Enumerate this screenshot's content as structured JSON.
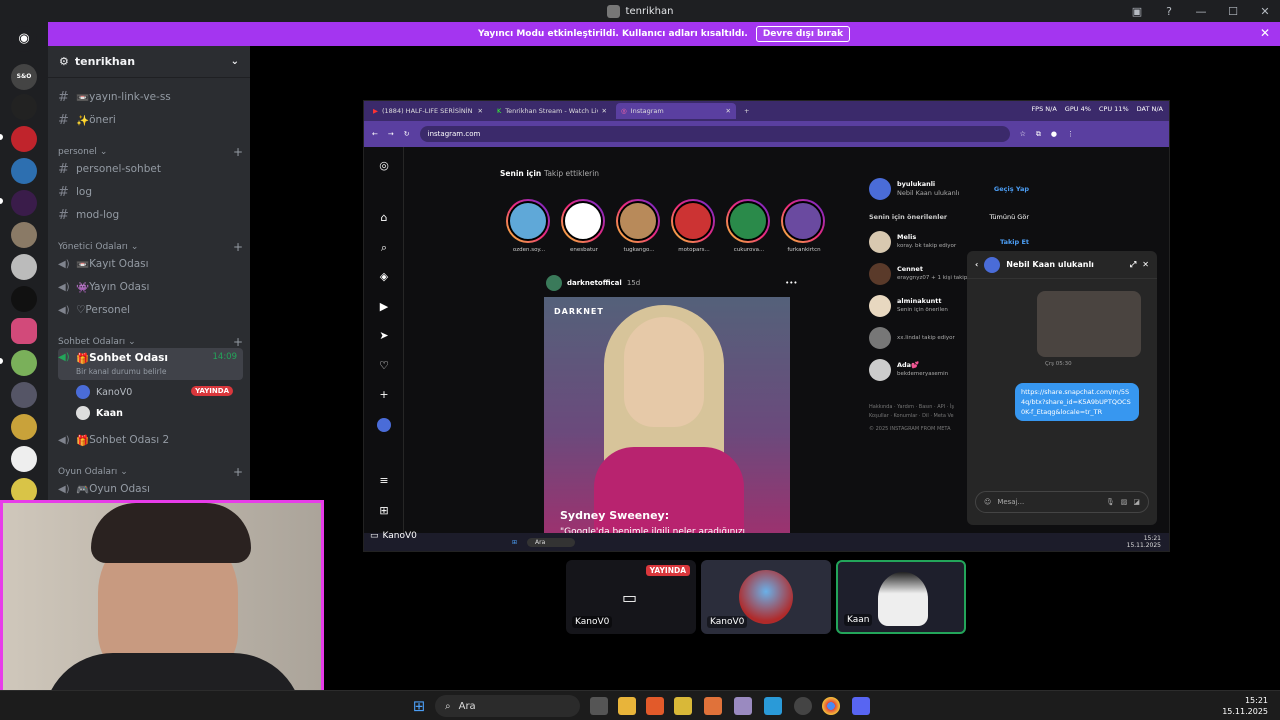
{
  "window": {
    "title": "tenrikhan"
  },
  "banner": {
    "text": "Yayıncı Modu etkinleştirildi. Kullanıcı adları kısaltıldı.",
    "button": "Devre dışı bırak"
  },
  "sidebar": {
    "guild": "tenrikhan",
    "channels_top": [
      {
        "name": "yayın-link-ve-ss",
        "emoji": "📼"
      },
      {
        "name": "öneri",
        "emoji": "✨"
      }
    ],
    "categories": {
      "personel": "personel",
      "yonetici": "Yönetici Odaları",
      "sohbet": "Sohbet Odaları",
      "oyun": "Oyun Odaları"
    },
    "personel_channels": [
      "personel-sohbet",
      "log",
      "mod-log"
    ],
    "yonetici_channels": [
      {
        "name": "Kayıt Odası",
        "emoji": "📼"
      },
      {
        "name": "Yayın Odası",
        "emoji": "👾"
      },
      {
        "name": "Personel",
        "emoji": "♡"
      }
    ],
    "active_voice": {
      "name": "Sohbet Odası",
      "emoji": "🎁",
      "time": "14:09",
      "status": "Bir kanal durumu belirle"
    },
    "voice_users": [
      {
        "name": "KanoV0",
        "live": "YAYINDA"
      },
      {
        "name": "Kaan",
        "live": ""
      }
    ],
    "voice_channel2": {
      "name": "Sohbet Odası 2",
      "emoji": "🎁"
    },
    "oyun_channels": [
      {
        "name": "Oyun Odası",
        "emoji": "🎮"
      }
    ]
  },
  "stream": {
    "owner_tag": "KanoV0",
    "browser": {
      "tabs": [
        "(1884) HALF-LIFE SERİSİNİN YA",
        "Tenrikhan Stream - Watch Liv",
        "Instagram"
      ],
      "stats": {
        "fps": "FPS N/A",
        "gpu": "GPU 4%",
        "cpu": "CPU 11%",
        "dat": "DAT N/A"
      },
      "url": "instagram.com"
    },
    "instagram": {
      "tab_for_you": "Senin için",
      "tab_following": "Takip ettiklerin",
      "stories": [
        "ozden.soy...",
        "enesbatur",
        "tugkango...",
        "motopars...",
        "cukurova...",
        "furkankirtcn"
      ],
      "post_user": "darknetoffical",
      "post_age": "15d",
      "post_brand": "DARKNET",
      "post_title": "Sydney Sweeney:",
      "post_caption": "\"Google'da benimle ilgili neler aradığınızı",
      "me_user": "byulukanli",
      "me_name": "Nebil Kaan ulukanlı",
      "switch": "Geçiş Yap",
      "suggestions_title": "Senin için önerilenler",
      "see_all": "Tümünü Gör",
      "suggestions": [
        {
          "name": "Melis",
          "sub": "koray. bk takip ediyor",
          "action": "Takip Et"
        },
        {
          "name": "Cennet",
          "sub": "eraygnyz07 + 1 kişi takip...",
          "action": ""
        },
        {
          "name": "alminakuntt",
          "sub": "Senin için önerilen",
          "action": ""
        },
        {
          "name": "",
          "sub": "xx.lindal takip ediyor",
          "action": ""
        },
        {
          "name": "Ada💕",
          "sub": "bekdemeryasemin",
          "action": ""
        }
      ],
      "footer1": "Hakkında · Yardım · Basın · API · İş",
      "footer2": "Koşullar · Konumlar · Dil · Meta Ve",
      "footer3": "© 2025 INSTAGRAM FROM META",
      "dm": {
        "name": "Nebil Kaan ulukanlı",
        "time": "Çrş 05:30",
        "link": "https://share.snapchat.com/m/5S4q/btx?share_id=K5A9bUPTQOCS0K-f_Etaqg&locale=tr_TR",
        "placeholder": "Mesaj..."
      }
    },
    "taskbar_search": "Ara",
    "taskbar_clock": {
      "time": "15:21",
      "date": "15.11.2025"
    }
  },
  "tiles": [
    {
      "name": "KanoV0",
      "live": "YAYINDA"
    },
    {
      "name": "KanoV0"
    },
    {
      "name": "Kaan"
    }
  ],
  "taskbar": {
    "search": "Ara",
    "time": "15:21",
    "date": "15.11.2025"
  }
}
